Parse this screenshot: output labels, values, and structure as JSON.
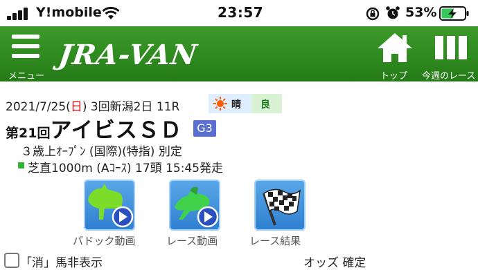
{
  "status_bar": {
    "carrier": "Y!mobile",
    "time": "23:57",
    "battery_percent": "53%",
    "battery_level": 0.53,
    "icons": [
      "signal-icon",
      "wifi-icon",
      "rotation-lock-icon",
      "alarm-icon",
      "battery-charging-icon"
    ]
  },
  "header": {
    "logo": "JRA-VAN",
    "menu_label": "メニュー",
    "home_label": "トップ",
    "week_label": "今週のレース",
    "color": "#2f8a1f"
  },
  "race": {
    "date_prefix": "2021/7/25(",
    "day": "日",
    "date_suffix": ") 3回新潟2日 11R",
    "weather": "晴",
    "track_condition": "良",
    "race_no": "第21回",
    "name": "アイビスＳＤ",
    "grade": "G3",
    "conditions": "３歳上ｵｰﾌﾟﾝ (国際)(特指) 別定",
    "course": "芝直1000m (Aｺｰｽ) 17頭 15:45発走"
  },
  "videos": [
    {
      "label": "パドック動画",
      "icon": "paddock-video-icon"
    },
    {
      "label": "レース動画",
      "icon": "race-video-icon"
    },
    {
      "label": "レース結果",
      "icon": "checkered-flag-icon"
    }
  ],
  "options": {
    "hide_scratched_label": "「消」馬非表示",
    "odds_label": "オッズ 確定"
  }
}
